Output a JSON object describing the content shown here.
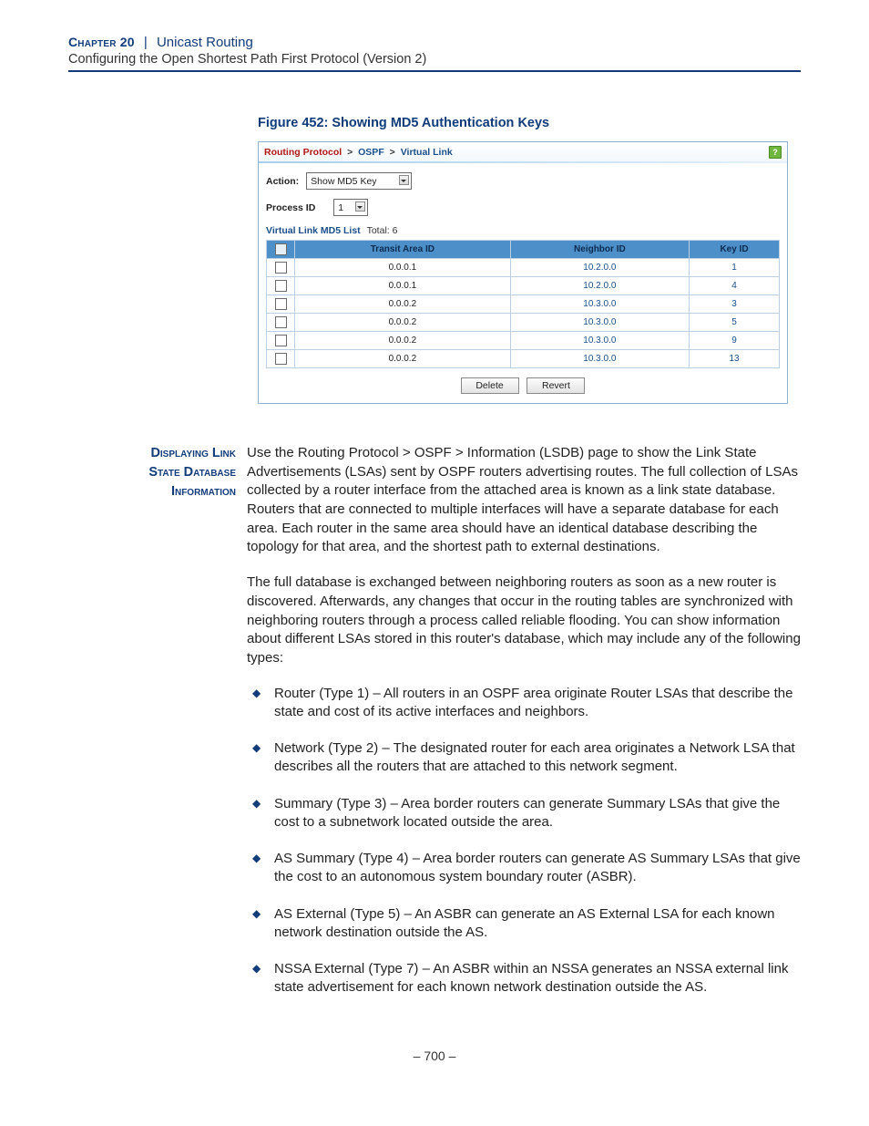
{
  "header": {
    "chapter": "Chapter 20",
    "sep": "|",
    "title": "Unicast Routing",
    "subtitle": "Configuring the Open Shortest Path First Protocol (Version 2)"
  },
  "figure": {
    "caption": "Figure 452:  Showing MD5 Authentication Keys"
  },
  "shot": {
    "breadcrumb": {
      "p1": "Routing Protocol",
      "sep": ">",
      "p2": "OSPF",
      "p3": "Virtual Link"
    },
    "help": "?",
    "action_label": "Action:",
    "action_value": "Show MD5 Key",
    "process_label": "Process ID",
    "process_value": "1",
    "list_label": "Virtual Link MD5 List",
    "list_total_label": "Total:",
    "list_total": "6",
    "columns": [
      "Transit Area ID",
      "Neighbor ID",
      "Key ID"
    ],
    "rows": [
      {
        "transit": "0.0.0.1",
        "neighbor": "10.2.0.0",
        "key": "1"
      },
      {
        "transit": "0.0.0.1",
        "neighbor": "10.2.0.0",
        "key": "4"
      },
      {
        "transit": "0.0.0.2",
        "neighbor": "10.3.0.0",
        "key": "3"
      },
      {
        "transit": "0.0.0.2",
        "neighbor": "10.3.0.0",
        "key": "5"
      },
      {
        "transit": "0.0.0.2",
        "neighbor": "10.3.0.0",
        "key": "9"
      },
      {
        "transit": "0.0.0.2",
        "neighbor": "10.3.0.0",
        "key": "13"
      }
    ],
    "buttons": {
      "delete": "Delete",
      "revert": "Revert"
    }
  },
  "section": {
    "sidehead": [
      "Displaying Link",
      "State Database",
      "Information"
    ],
    "para1": "Use the Routing Protocol > OSPF > Information (LSDB) page to show the Link State Advertisements (LSAs) sent by OSPF routers advertising routes. The full collection of LSAs collected by a router interface from the attached area is known as a link state database. Routers that are connected to multiple interfaces will have a separate database for each area. Each router in the same area should have an identical database describing the topology for that area, and the shortest path to external destinations.",
    "para2": "The full database is exchanged between neighboring routers as soon as a new router is discovered. Afterwards, any changes that occur in the routing tables are synchronized with neighboring routers through a process called reliable flooding. You can show information about different LSAs stored in this router's database, which may include any of the following types:",
    "bullets": [
      "Router (Type 1) – All routers in an OSPF area originate Router LSAs that describe the state and cost of its active interfaces and neighbors.",
      "Network (Type 2) – The designated router for each area originates a Network LSA that describes all the routers that are attached to this network segment.",
      "Summary (Type 3) – Area border routers can generate Summary LSAs that give the cost to a subnetwork located outside the area.",
      "AS Summary (Type 4) – Area border routers can generate AS Summary LSAs that give the cost to an autonomous system boundary router (ASBR).",
      "AS External (Type 5) – An ASBR can generate an AS External LSA for each known network destination outside the AS.",
      "NSSA External (Type 7) – An ASBR within an NSSA generates an NSSA external link state advertisement for each known network destination outside the AS."
    ]
  },
  "page_number": "–  700  –"
}
